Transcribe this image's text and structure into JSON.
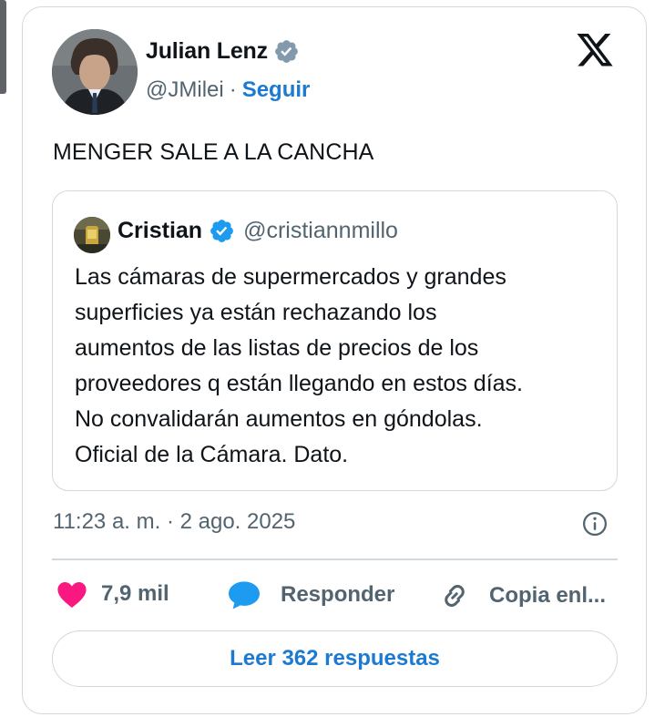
{
  "tweet": {
    "author": {
      "name": "Julian Lenz",
      "handle": "@JMilei",
      "follow_label": "Seguir",
      "separator": "·",
      "avatar_icon": "person-portrait-avatar",
      "verified_icon": "verified-badge-icon"
    },
    "platform_icon": "x-logo-icon",
    "text": "MENGER SALE A LA CANCHA",
    "quote": {
      "name": "Cristian",
      "handle": "@cristiannmillo",
      "verified_icon": "verified-badge-icon",
      "lines": [
        "Las cámaras de supermercados y grandes",
        "superficies ya están rechazando los",
        "aumentos de las listas de precios de los",
        "proveedores q están llegando en estos días.",
        "No convalidarán aumentos en góndolas.",
        "Oficial de la Cámara. Dato."
      ]
    },
    "timestamp": "11:23 a. m. · 2 ago. 2025",
    "actions": {
      "like_count": "7,9 mil",
      "reply_label": "Responder",
      "copy_label": "Copia enl..."
    },
    "read_replies_label": "Leer 362 respuestas"
  },
  "colors": {
    "link_blue": "#1d7ad2",
    "verified_blue": "#1d9bf0",
    "verified_grey": "#829aab",
    "like_pink": "#f91880",
    "reply_blue": "#1d9bf0",
    "text_primary": "#0f1419",
    "text_secondary": "#536471",
    "border": "#cfd9de"
  }
}
